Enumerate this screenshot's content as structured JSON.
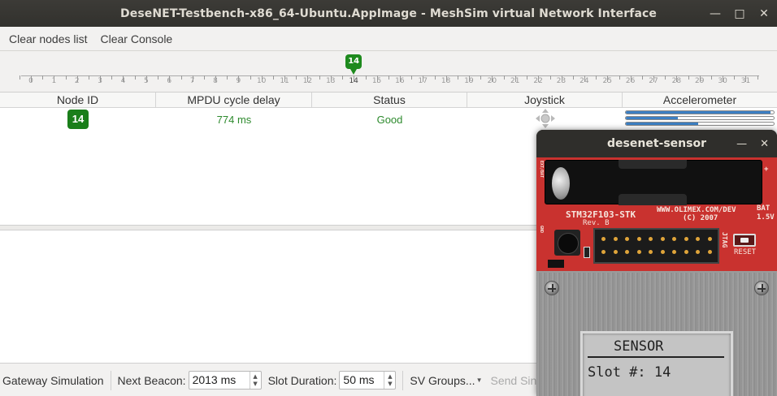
{
  "window": {
    "title": "DeseNET-Testbench-x86_64-Ubuntu.AppImage - MeshSim virtual Network Interface"
  },
  "menu": {
    "items": [
      "Clear nodes list",
      "Clear Console"
    ]
  },
  "timeline": {
    "slots": [
      "0",
      "1",
      "2",
      "3",
      "4",
      "5",
      "6",
      "7",
      "8",
      "9",
      "10",
      "11",
      "12",
      "13",
      "14",
      "15",
      "16",
      "17",
      "18",
      "19",
      "20",
      "21",
      "22",
      "23",
      "24",
      "25",
      "26",
      "27",
      "28",
      "29",
      "30",
      "31"
    ],
    "active_slot_label": "14"
  },
  "table": {
    "headers": [
      "Node ID",
      "MPDU cycle delay",
      "Status",
      "Joystick",
      "Accelerometer"
    ],
    "rows": [
      {
        "node_id": "14",
        "delay": "774 ms",
        "status": "Good",
        "accelerometer": [
          0.98,
          0.35,
          0.49
        ]
      }
    ]
  },
  "toolbar": {
    "gateway_label": "Gateway Simulation",
    "next_beacon_label": "Next Beacon:",
    "next_beacon_value": "2013 ms",
    "slot_duration_label": "Slot Duration:",
    "slot_duration_value": "50 ms",
    "sv_groups_label": "SV Groups...",
    "send_single_label": "Send Single B"
  },
  "sensor_window": {
    "title": "desenet-sensor",
    "board": {
      "model": "STM32F103-STK",
      "rev": "Rev. B",
      "url": "WWW.OLIMEX.COM/DEV",
      "copyright": "(C) 2007",
      "bat": "BAT",
      "bat_volt": "1.5V",
      "ext_bat": "EXT/BAT",
      "gnd": "GND",
      "jtag": "JTAG",
      "reset": "RESET",
      "plus": "+"
    },
    "lcd": {
      "title": "SENSOR",
      "line": "Slot #: 14"
    }
  },
  "colors": {
    "accent_green": "#1e8a1e",
    "status_green": "#2d8a2d",
    "accel_blue": "#3c7fc3",
    "board_red": "#c9322f"
  }
}
